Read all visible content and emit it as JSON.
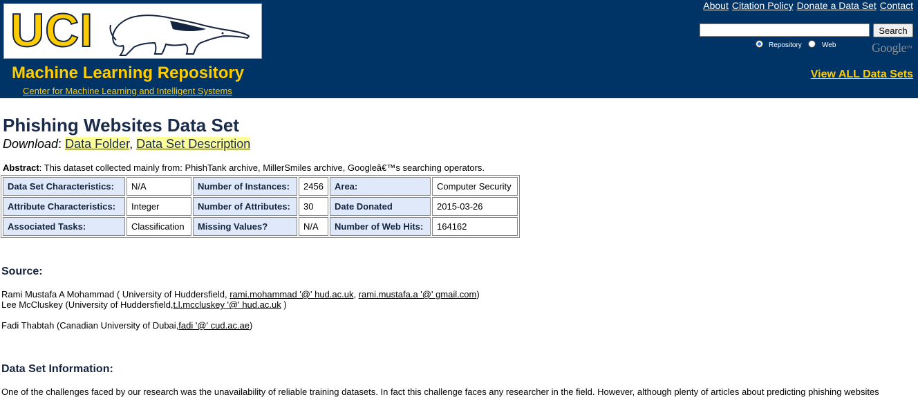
{
  "header": {
    "logo_text": "UCI",
    "repo_title": "Machine Learning Repository",
    "repo_subtitle": "Center for Machine Learning and Intelligent Systems",
    "top_links": [
      "About",
      "Citation Policy",
      "Donate a Data Set",
      "Contact"
    ],
    "search_button": "Search",
    "search_value": "",
    "radio_repository": "Repository",
    "radio_web": "Web",
    "google_logo": "Google",
    "view_all": "View ALL Data Sets"
  },
  "page": {
    "title": "Phishing Websites Data Set",
    "download_label": "Download",
    "download_links": [
      "Data Folder",
      "Data Set Description"
    ],
    "abstract_label": "Abstract",
    "abstract_text": ": This dataset collected mainly from: PhishTank archive, MillerSmiles archive, Googleâ€™s searching operators."
  },
  "characteristics": [
    [
      "Data Set Characteristics:",
      "N/A",
      "Number of Instances:",
      "2456",
      "Area:",
      "Computer Security"
    ],
    [
      "Attribute Characteristics:",
      "Integer",
      "Number of Attributes:",
      "30",
      "Date Donated",
      "2015-03-26"
    ],
    [
      "Associated Tasks:",
      "Classification",
      "Missing Values?",
      "N/A",
      "Number of Web Hits:",
      "164162"
    ]
  ],
  "source": {
    "heading": "Source:",
    "line1_prefix": "Rami Mustafa A Mohammad ( University of Huddersfield, ",
    "line1_email1": "rami.mohammad '@' hud.ac.uk",
    "line1_sep": ", ",
    "line1_email2": "rami.mustafa.a '@' gmail.com",
    "line1_suffix": ")",
    "line2_prefix": "Lee McCluskey (University of Huddersfield,",
    "line2_email": "t.l.mccluskey '@' hud.ac.uk",
    "line2_suffix": " )",
    "line3_prefix": "Fadi Thabtah (Canadian University of Dubai,",
    "line3_email": "fadi '@' cud.ac.ae",
    "line3_suffix": ")"
  },
  "info": {
    "heading": "Data Set Information:",
    "text": "One of the challenges faced by our research was the unavailability of reliable training datasets. In fact this challenge faces any researcher in the field. However, although plenty of articles about predicting phishing websites"
  },
  "colors": {
    "header_bg": "#003366",
    "brand_yellow": "#ffcc00",
    "link_highlight": "#ffff99",
    "table_header_bg": "#dfe9fa"
  }
}
